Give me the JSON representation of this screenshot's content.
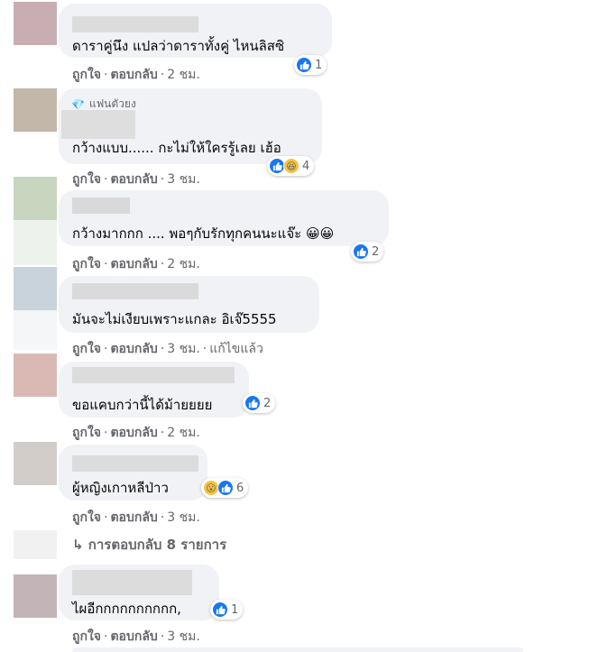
{
  "labels": {
    "like": "ถูกใจ",
    "reply": "ตอบกลับ",
    "dot": "·"
  },
  "comments": [
    {
      "text": "ดาราคู่นึง แปลว่าดาราทั้งคู่ ไหนลิสซิ",
      "time": "2 ชม.",
      "reactions": [
        "like"
      ],
      "count": "1"
    },
    {
      "badge": "แฟนตัวยง",
      "text": "กว้างแบบ...... กะไม่ให้ใครรู้เลย เฮ้อ",
      "time": "3 ชม.",
      "reactions": [
        "like",
        "haha"
      ],
      "count": "4"
    },
    {
      "text": "กว้างมากกก .... พอๆกับรักทุกคนนะแจ๊ะ 😀😀",
      "time": "2 ชม.",
      "reactions": [
        "like"
      ],
      "count": "2"
    },
    {
      "text": "มันจะไม่เงียบเพราะแกละ อิเจ๊5555",
      "time": "3 ชม.",
      "edited": "แก้ไขแล้ว",
      "reactions": [],
      "count": ""
    },
    {
      "text": "ขอแคบกว่านี้ได้ม้ายยยย",
      "time": "2 ชม.",
      "reactions": [
        "like"
      ],
      "count": "2"
    },
    {
      "text": "ผู้หญิงเกาหลีป่าว",
      "time": "3 ชม.",
      "reactions": [
        "wow",
        "like"
      ],
      "count": "6"
    },
    {
      "text": "ไผอีกกกกกกกกกก,",
      "time": "3 ชม.",
      "reactions": [
        "like"
      ],
      "count": "1"
    }
  ],
  "more_replies": "↳ การตอบกลับ 8 รายการ",
  "colors": {
    "bubble": "#f0f2f5",
    "meta": "#65676b",
    "like": "#1877f2"
  }
}
